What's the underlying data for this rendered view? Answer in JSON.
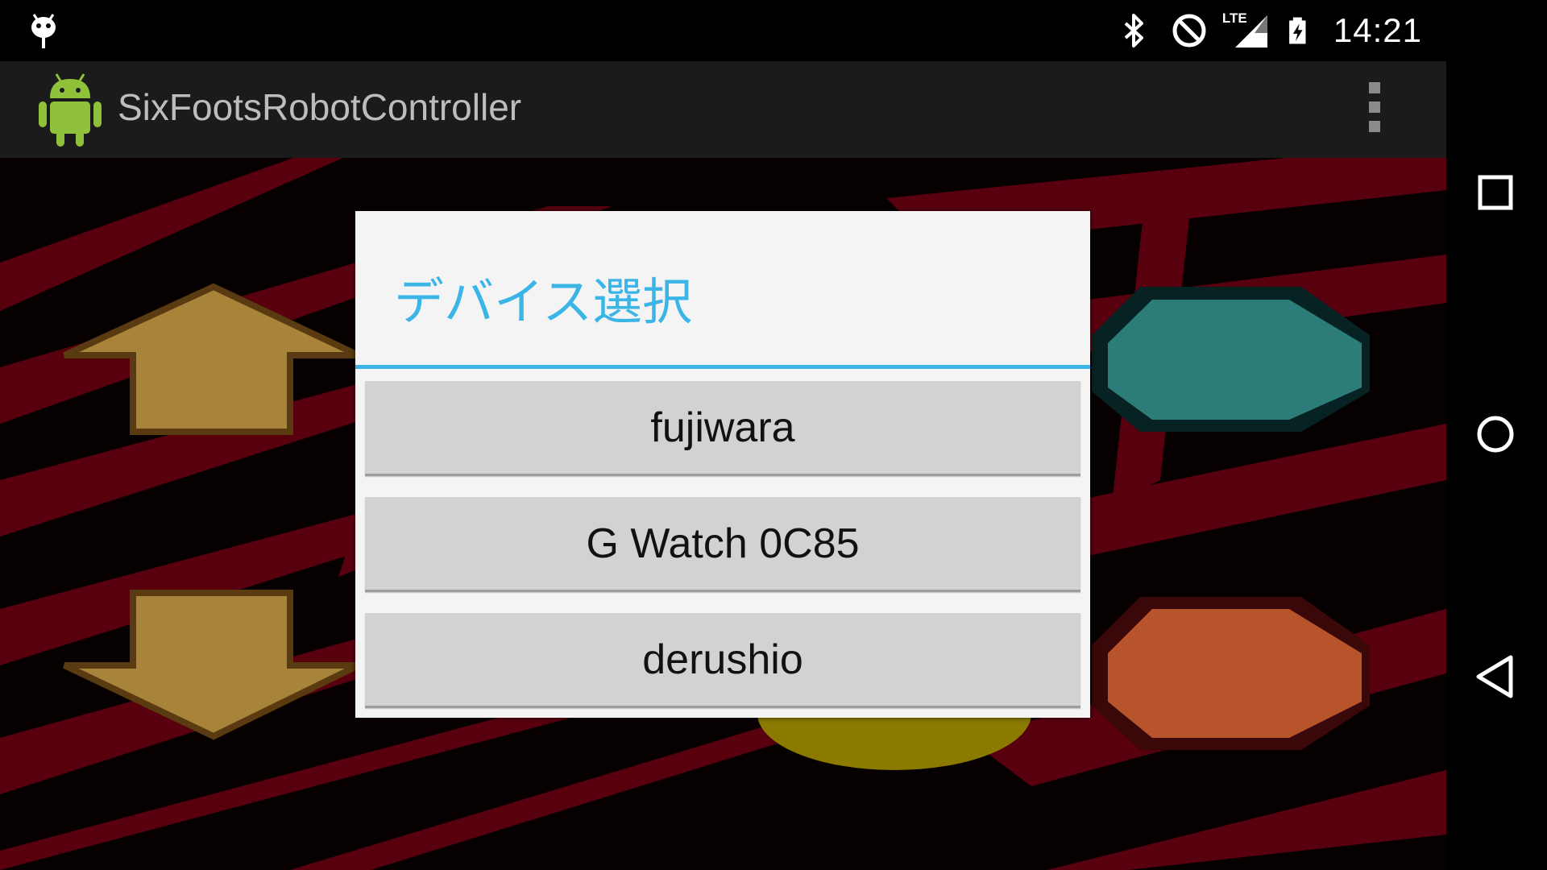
{
  "status_bar": {
    "time": "14:21",
    "network_label": "LTE",
    "icons": [
      "android-notification-icon",
      "bluetooth-icon",
      "do-not-disturb-icon",
      "lte-signal-icon",
      "battery-charging-icon"
    ]
  },
  "action_bar": {
    "app_title": "SixFootsRobotController",
    "app_icon": "android-robot-icon",
    "overflow_icon": "overflow-menu-icon"
  },
  "dialog": {
    "title": "デバイス選択",
    "devices": [
      {
        "label": "fujiwara"
      },
      {
        "label": "G Watch 0C85"
      },
      {
        "label": "derushio"
      }
    ]
  },
  "navigation": {
    "icons": [
      "recents-icon",
      "home-icon",
      "back-icon"
    ]
  },
  "colors": {
    "accent": "#3bb4e6",
    "background_stripe": "#6a0010",
    "arrow_gold": "#a8843a",
    "teal_button": "#2a7a7a",
    "orange_button": "#c4552a",
    "yellow_button": "#b8a000"
  }
}
